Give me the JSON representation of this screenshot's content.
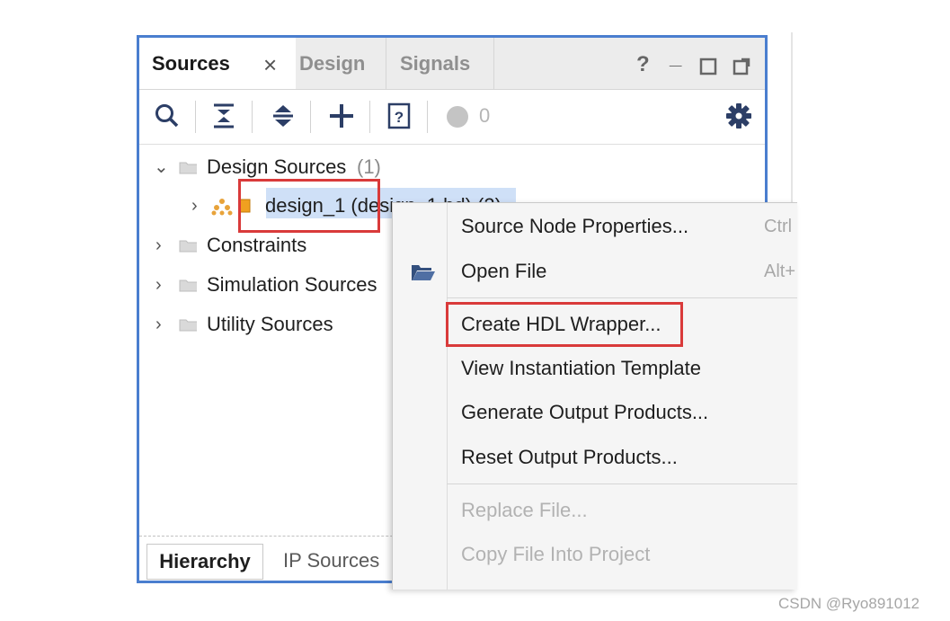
{
  "tabs": {
    "sources": "Sources",
    "design": "Design",
    "signals": "Signals",
    "close_glyph": "×"
  },
  "window_controls": {
    "help": "?",
    "minimize": "_"
  },
  "toolbar": {
    "icons": [
      "search-icon",
      "collapse-all-icon",
      "expand-all-icon",
      "add-icon",
      "unknown-source-icon",
      "status-circle-icon",
      "gear-icon"
    ],
    "count": "0"
  },
  "tree": {
    "design_sources": {
      "label": "Design Sources",
      "count": "(1)"
    },
    "design_1": {
      "label": "design_1 (design_1.bd) (2)"
    },
    "constraints": {
      "label": "Constraints"
    },
    "simulation_sources": {
      "label": "Simulation Sources"
    },
    "utility_sources": {
      "label": "Utility Sources"
    }
  },
  "bottom_tabs": {
    "hierarchy": "Hierarchy",
    "ip_sources": "IP Sources"
  },
  "context_menu": {
    "items": [
      {
        "label": "Source Node Properties...",
        "shortcut": "Ctrl"
      },
      {
        "label": "Open File",
        "shortcut": "Alt+"
      },
      {
        "label": "Create HDL Wrapper..."
      },
      {
        "label": "View Instantiation Template"
      },
      {
        "label": "Generate Output Products..."
      },
      {
        "label": "Reset Output Products..."
      },
      {
        "label": "Replace File..."
      },
      {
        "label": "Copy File Into Project"
      }
    ]
  },
  "colors": {
    "panel_border": "#4a7ecf",
    "highlight_box": "#d93a3a",
    "selection": "#cfe0f7"
  },
  "watermark": "CSDN @Ryo891012"
}
